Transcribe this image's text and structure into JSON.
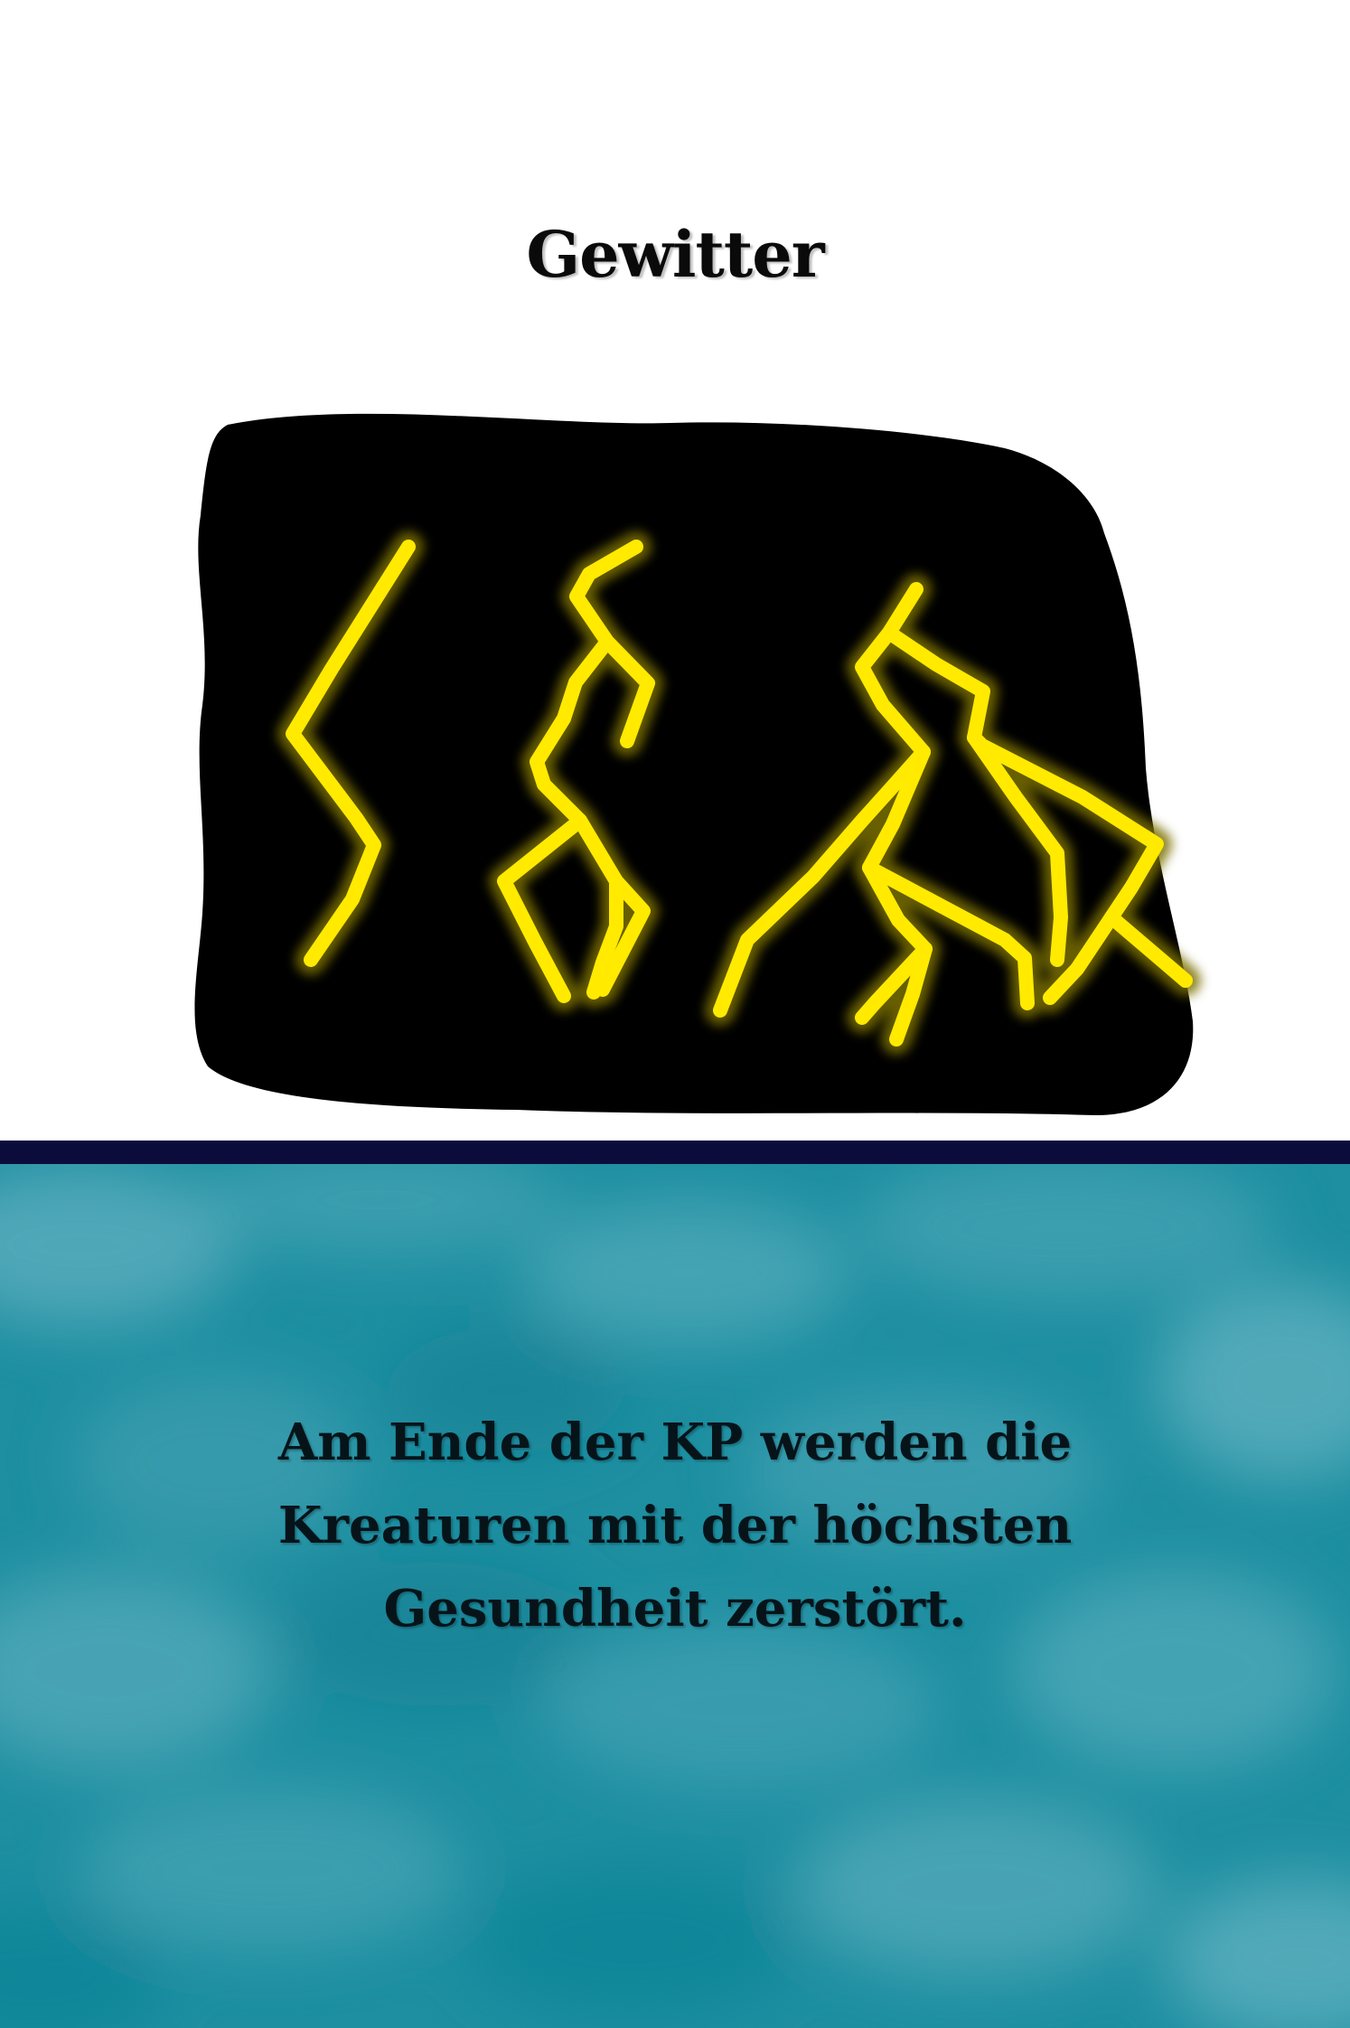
{
  "card": {
    "title": "Gewitter",
    "artwork": {
      "icon": "thunderstorm-lightning-icon",
      "cloud_color": "#000000",
      "bolt_color": "#ffea00"
    },
    "divider_color": "#0c0c3c",
    "text_panel_color": "#1d8fa1",
    "rules_text": [
      "Am Ende der KP werden die",
      "Kreaturen mit der höchsten",
      "Gesundheit zerstört."
    ]
  }
}
